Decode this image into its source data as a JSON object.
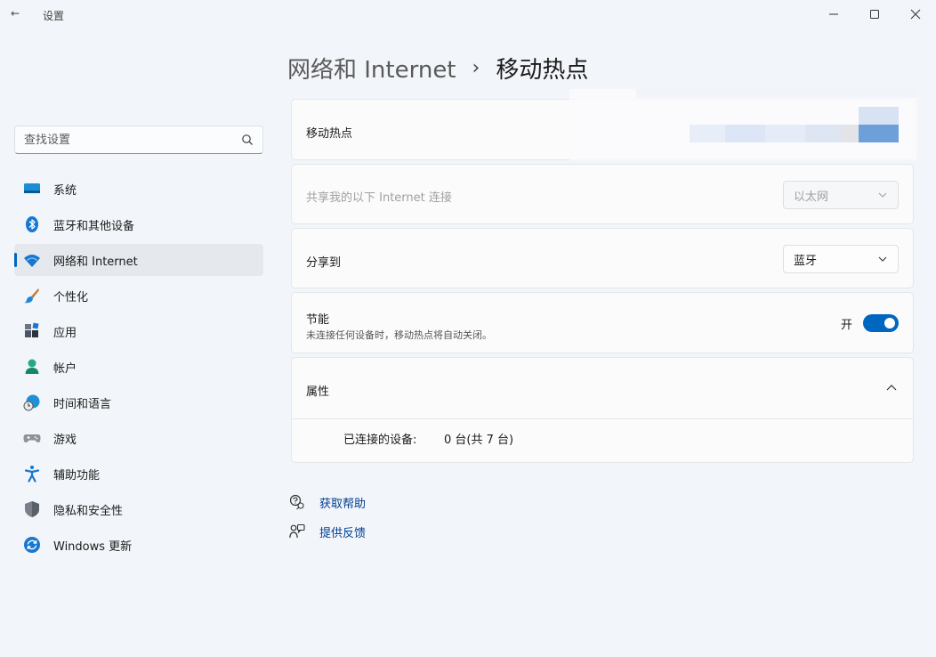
{
  "window": {
    "back_glyph": "←",
    "title": "设置",
    "controls": [
      "minimize-icon",
      "maximize-icon",
      "close-icon"
    ]
  },
  "search": {
    "placeholder": "查找设置",
    "icon": "search-icon"
  },
  "sidebar": {
    "items": [
      {
        "label": "系统",
        "icon": "system-display-icon",
        "active": false
      },
      {
        "label": "蓝牙和其他设备",
        "icon": "bluetooth-icon",
        "active": false
      },
      {
        "label": "网络和 Internet",
        "icon": "wifi-icon",
        "active": true
      },
      {
        "label": "个性化",
        "icon": "paintbrush-icon",
        "active": false
      },
      {
        "label": "应用",
        "icon": "apps-icon",
        "active": false
      },
      {
        "label": "帐户",
        "icon": "account-icon",
        "active": false
      },
      {
        "label": "时间和语言",
        "icon": "globe-clock-icon",
        "active": false
      },
      {
        "label": "游戏",
        "icon": "gamepad-icon",
        "active": false
      },
      {
        "label": "辅助功能",
        "icon": "accessibility-icon",
        "active": false
      },
      {
        "label": "隐私和安全性",
        "icon": "shield-icon",
        "active": false
      },
      {
        "label": "Windows 更新",
        "icon": "windows-update-icon",
        "active": false
      }
    ]
  },
  "breadcrumb": {
    "parent": "网络和 Internet",
    "separator": "›",
    "current": "移动热点"
  },
  "cards": {
    "hotspot": {
      "label": "移动热点"
    },
    "share_from": {
      "label": "共享我的以下 Internet 连接",
      "value": "以太网",
      "disabled": true
    },
    "share_to": {
      "label": "分享到",
      "value": "蓝牙"
    },
    "power_saving": {
      "label": "节能",
      "description": "未连接任何设备时，移动热点将自动关闭。",
      "state_label": "开",
      "on": true
    },
    "properties": {
      "label": "属性",
      "expanded": true,
      "connected_label": "已连接的设备:",
      "connected_value": "0 台(共 7 台)"
    }
  },
  "links": [
    {
      "label": "获取帮助",
      "icon": "help-icon"
    },
    {
      "label": "提供反馈",
      "icon": "feedback-icon"
    }
  ],
  "colors": {
    "accent": "#0067c0",
    "background": "#f2f5f9",
    "card": "#fbfbfc",
    "link": "#003e92"
  }
}
